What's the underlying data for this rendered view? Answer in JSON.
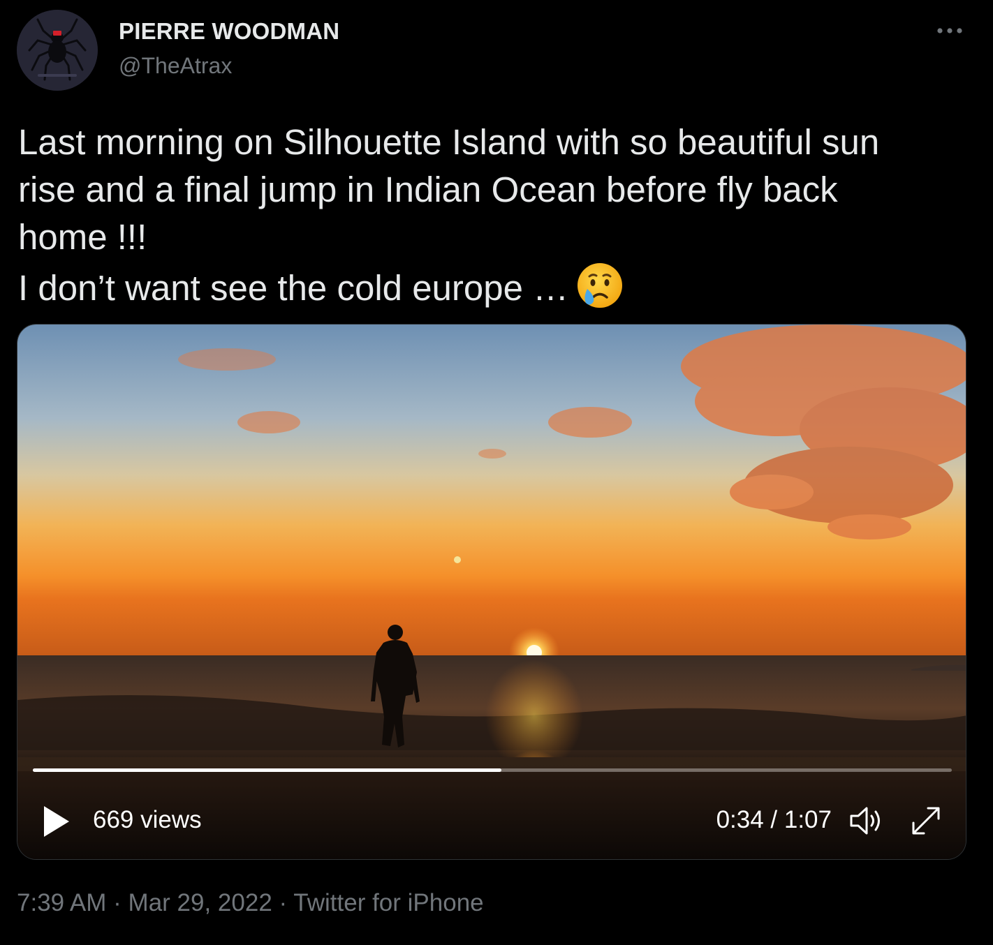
{
  "author": {
    "display_name": "PIERRE WOODMAN",
    "handle": "@TheAtrax",
    "avatar_icon": "spider-icon"
  },
  "more_icon": "more-dots-icon",
  "tweet": {
    "lines": [
      "Last morning on Silhouette Island with so beautiful sun",
      "rise and a final jump in Indian Ocean before fly back",
      "home !!!",
      "I don’t want see the cold europe …"
    ],
    "emoji": "crying-face-emoji"
  },
  "video": {
    "views": "669 views",
    "time": "0:34 / 1:07",
    "progress": 0.51,
    "play_icon": "play-icon",
    "volume_icon": "speaker-icon",
    "fullscreen_icon": "expand-icon"
  },
  "meta": {
    "time": "7:39 AM",
    "separator": "·",
    "date": "Mar 29, 2022",
    "source": "Twitter for iPhone"
  },
  "colors": {
    "background": "#000000",
    "text": "#e7e9ea",
    "secondary_text": "#71767b",
    "accent_sun": "#ff9a2e"
  }
}
